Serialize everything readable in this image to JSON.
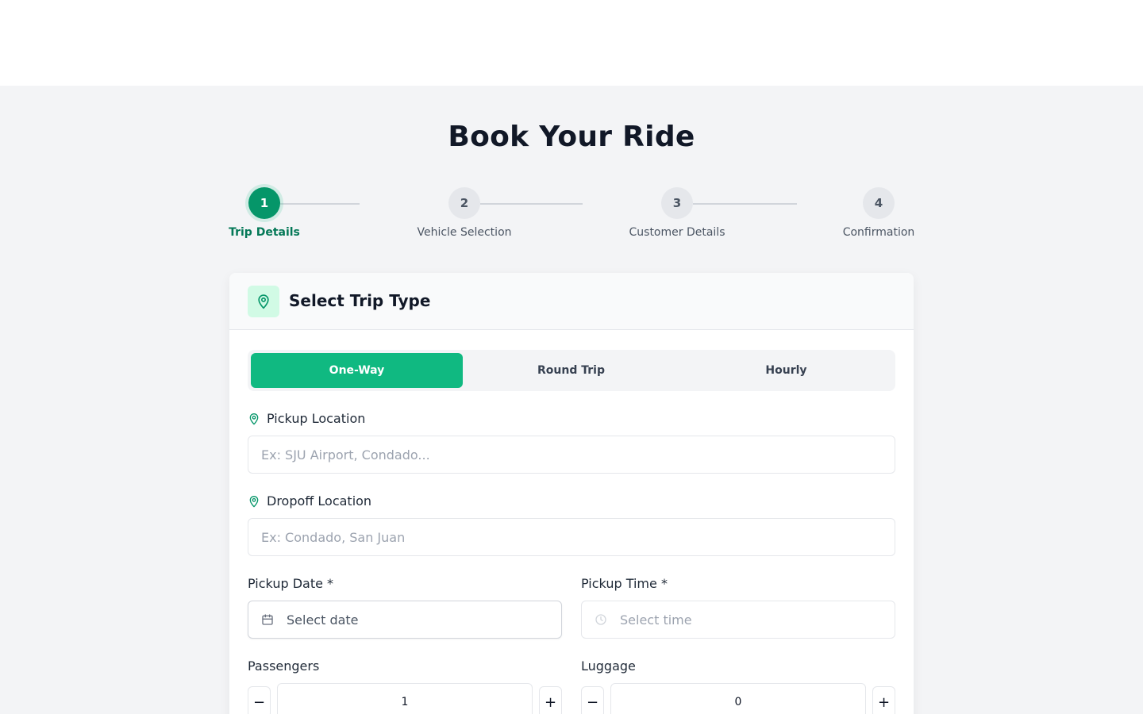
{
  "page": {
    "title": "Book Your Ride"
  },
  "stepper": {
    "steps": [
      {
        "number": "1",
        "label": "Trip Details",
        "active": true
      },
      {
        "number": "2",
        "label": "Vehicle Selection",
        "active": false
      },
      {
        "number": "3",
        "label": "Customer Details",
        "active": false
      },
      {
        "number": "4",
        "label": "Confirmation",
        "active": false
      }
    ]
  },
  "card": {
    "title": "Select Trip Type",
    "header_icon": "map-pin-icon",
    "trip_types": [
      {
        "label": "One-Way",
        "selected": true
      },
      {
        "label": "Round Trip",
        "selected": false
      },
      {
        "label": "Hourly",
        "selected": false
      }
    ],
    "pickup": {
      "label": "Pickup Location",
      "value": "",
      "placeholder": "Ex: SJU Airport, Condado..."
    },
    "dropoff": {
      "label": "Dropoff Location",
      "value": "",
      "placeholder": "Ex: Condado, San Juan"
    },
    "date": {
      "label": "Pickup Date *",
      "placeholder": "Select date",
      "icon": "calendar-icon"
    },
    "time": {
      "label": "Pickup Time *",
      "placeholder": "Select time",
      "icon": "clock-icon"
    },
    "passengers": {
      "label": "Passengers",
      "value": "1",
      "minus": "−",
      "plus": "+"
    },
    "luggage": {
      "label": "Luggage",
      "value": "0",
      "minus": "−",
      "plus": "+"
    }
  },
  "colors": {
    "accent": "#10b981",
    "accent_dark": "#059669",
    "accent_text": "#047857",
    "accent_light": "#d1fae5",
    "background": "#f3f4f6"
  }
}
